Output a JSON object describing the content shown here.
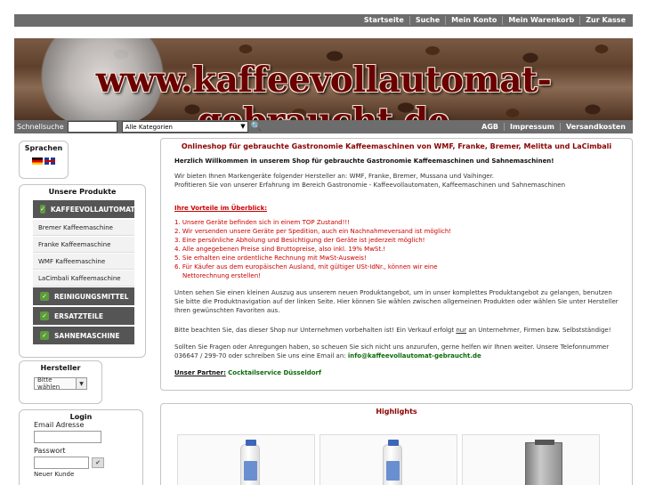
{
  "topnav": [
    "Startseite",
    "Suche",
    "Mein Konto",
    "Mein Warenkorb",
    "Zur Kasse"
  ],
  "banner": {
    "title": "www.kaffeevollautomat-gebraucht.de"
  },
  "search": {
    "label": "Schnellsuche",
    "value": "",
    "category": "Alle Kategorien",
    "links": [
      "AGB",
      "Impressum",
      "Versandkosten"
    ]
  },
  "sidebar": {
    "languages_title": "Sprachen",
    "products_title": "Unsere Produkte",
    "products": [
      {
        "label": "KAFFEEVOLLAUTOMATEN",
        "style": "dark"
      },
      {
        "label": "Bremer Kaffeemaschine",
        "style": "light"
      },
      {
        "label": "Franke Kaffeemaschine",
        "style": "light"
      },
      {
        "label": "WMF Kaffeemaschine",
        "style": "light"
      },
      {
        "label": "LaCimbali Kaffeemaschine",
        "style": "light"
      },
      {
        "label": "REINIGUNGSMITTEL",
        "style": "dark"
      },
      {
        "label": "ERSATZTEILE",
        "style": "dark"
      },
      {
        "label": "SAHNEMASCHINE",
        "style": "dark"
      }
    ],
    "maker_title": "Hersteller",
    "maker_select": "Bitte wählen",
    "login_title": "Login",
    "email_label": "Email Adresse",
    "password_label": "Passwort",
    "more_label": "Neuer Kunde"
  },
  "main": {
    "title": "Onlineshop für gebrauchte Gastronomie Kaffeemaschinen von WMF, Franke, Bremer, Melitta und LaCimbali",
    "welcome": "Herzlich Willkommen in unserem Shop für gebrauchte Gastronomie Kaffeemaschinen und Sahnemaschinen!",
    "intro1": "Wir bieten Ihnen Markengeräte folgender Hersteller an: WMF, Franke, Bremer, Mussana und Vaihinger.",
    "intro2": "Profitieren Sie von unserer Erfahrung im Bereich Gastronomie - Kaffeevollautomaten, Kaffeemaschinen und Sahnemaschinen",
    "advantages_title": "Ihre Vorteile im Überblick:",
    "advantages": [
      "1. Unsere Geräte befinden sich in einem TOP Zustand!!!",
      "2. Wir versenden unsere Geräte per Spedition, auch ein Nachnahmeversand ist möglich!",
      "3. Eine persönliche Abholung und Besichtigung der Geräte ist jederzeit möglich!",
      "4. Alle angegebenen Preise sind Bruttopreise, also inkl. 19% MwSt.!",
      "5. Sie erhalten eine ordentliche Rechnung mit MwSt-Ausweis!",
      "6. Für Käufer aus dem europäischen Ausland, mit gültiger USt-IdNr., können wir eine"
    ],
    "advantage6_cont": "Nettorechnung erstellen!",
    "para1": "Unten sehen Sie einen kleinen Auszug aus unserem neuen Produktangebot, um in unser komplettes Produktangebot zu gelangen, benutzen Sie bitte die Produktnavigation auf der linken Seite. Hier können Sie wählen zwischen allgemeinen Produkten oder wählen Sie unter Hersteller Ihren gewünschten Favoriten aus.",
    "para2_pre": "Bitte beachten Sie, das dieser Shop nur Unternehmen vorbehalten ist! Ein Verkauf erfolgt ",
    "para2_nur": "nur",
    "para2_post": " an Unternehmer, Firmen bzw. Selbstständige!",
    "para3": "Sollten Sie Fragen oder Anregungen haben, so scheuen Sie sich nicht uns anzurufen, gerne helfen wir Ihnen weiter. Unsere Telefonnummer 036647 / 299-70 oder schreiben Sie uns eine Email an: ",
    "email": "info@kaffeevollautomat-gebraucht.de",
    "partner_label": "Unser Partner:",
    "partner_name": "Cocktailservice Düsseldorf"
  },
  "highlights": {
    "title": "Highlights",
    "items": [
      {
        "type": "bottle"
      },
      {
        "type": "bottle"
      },
      {
        "type": "machine"
      }
    ]
  },
  "colors": {
    "nav_bg": "#6d6d6d",
    "title_red": "#8b0000",
    "advantage_red": "#c00000",
    "link_green": "#0a6a0a",
    "category_dark": "#555555",
    "check_green": "#5c9a3a"
  }
}
